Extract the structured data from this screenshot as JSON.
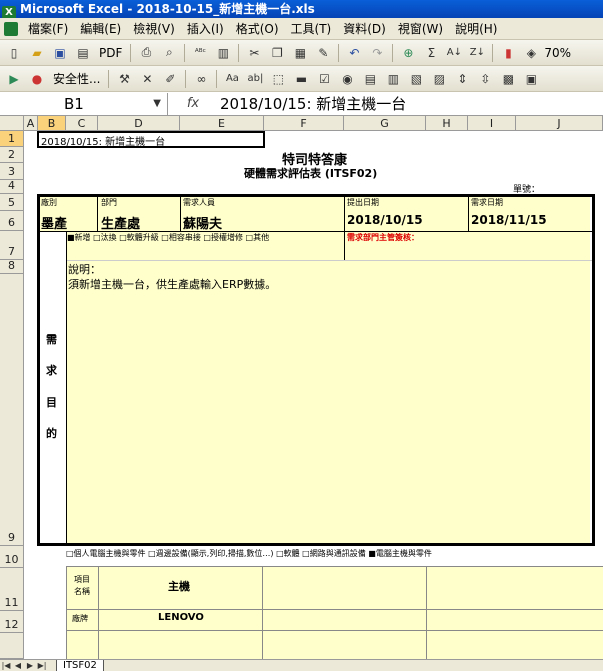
{
  "window": {
    "title": "Microsoft Excel - 2018-10-15_新增主機一台.xls",
    "app_icon": "excel-icon"
  },
  "menu": [
    "檔案(F)",
    "編輯(E)",
    "檢視(V)",
    "插入(I)",
    "格式(O)",
    "工具(T)",
    "資料(D)",
    "視窗(W)",
    "說明(H)"
  ],
  "toolbar1": {
    "pdf_label": "PDF",
    "zoom": "70%"
  },
  "toolbar2": {
    "security_label": "安全性..."
  },
  "formula_bar": {
    "name_box": "B1",
    "fx": "fx",
    "content": "2018/10/15: 新增主機一台"
  },
  "columns": [
    "A",
    "B",
    "C",
    "D",
    "E",
    "F",
    "G",
    "H",
    "I",
    "J"
  ],
  "rows": [
    "1",
    "2",
    "3",
    "4",
    "5",
    "6",
    "7",
    "8",
    "9",
    "10",
    "11",
    "12"
  ],
  "sheet": {
    "b1": "2018/10/15: 新增主機一台",
    "company": "特司特答康",
    "form_title": "硬體需求評估表 (ITSF02)",
    "doc_no_label": "單號：",
    "h_unit": "廠別",
    "h_dept": "部門",
    "h_requester": "需求人員",
    "h_submit_date": "提出日期",
    "h_need_date": "需求日期",
    "v_unit": "墨產",
    "v_dept": "生產處",
    "v_requester": "蘇陽夫",
    "v_submit_date": "2018/10/15",
    "v_need_date": "2018/11/15",
    "req_types": "■新增 □汰換 □軟體升級 □相容串接 □授權增修 □其他",
    "supervisor_sign": "需求部門主管簽核：",
    "purpose_chars": [
      "需",
      "求",
      "目",
      "的"
    ],
    "desc_label": "說明：",
    "desc_text": "須新增主機一台，供生產處輸入ERP數據。",
    "hw_types": "□個人電腦主機與零件 □週邊設備(顯示,列印,掃描,數位…) □軟體 □網路與通訊設備 ■電腦主機與零件",
    "item_name_label_1": "項目",
    "item_name_label_2": "名稱",
    "item_name_value": "主機",
    "brand_label": "廠牌",
    "brand_value": "LENOVO"
  },
  "sheet_tab": "ITSF02"
}
